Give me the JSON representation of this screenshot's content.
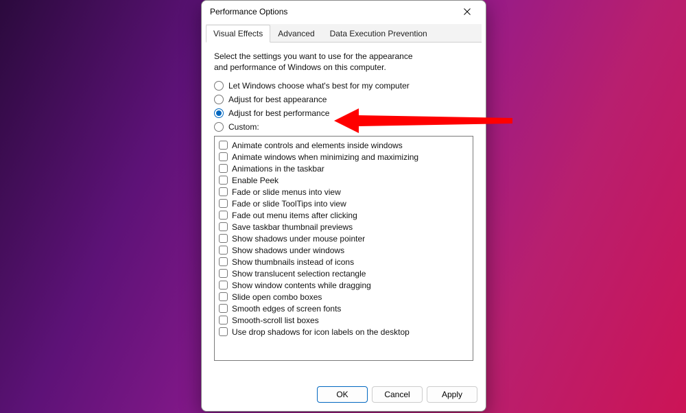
{
  "window": {
    "title": "Performance Options"
  },
  "tabs": [
    {
      "label": "Visual Effects",
      "active": true
    },
    {
      "label": "Advanced",
      "active": false
    },
    {
      "label": "Data Execution Prevention",
      "active": false
    }
  ],
  "description": "Select the settings you want to use for the appearance and performance of Windows on this computer.",
  "radios": [
    {
      "label": "Let Windows choose what's best for my computer",
      "selected": false
    },
    {
      "label": "Adjust for best appearance",
      "selected": false
    },
    {
      "label": "Adjust for best performance",
      "selected": true
    },
    {
      "label": "Custom:",
      "selected": false
    }
  ],
  "checklist": [
    "Animate controls and elements inside windows",
    "Animate windows when minimizing and maximizing",
    "Animations in the taskbar",
    "Enable Peek",
    "Fade or slide menus into view",
    "Fade or slide ToolTips into view",
    "Fade out menu items after clicking",
    "Save taskbar thumbnail previews",
    "Show shadows under mouse pointer",
    "Show shadows under windows",
    "Show thumbnails instead of icons",
    "Show translucent selection rectangle",
    "Show window contents while dragging",
    "Slide open combo boxes",
    "Smooth edges of screen fonts",
    "Smooth-scroll list boxes",
    "Use drop shadows for icon labels on the desktop"
  ],
  "buttons": {
    "ok": "OK",
    "cancel": "Cancel",
    "apply": "Apply"
  },
  "annotation": {
    "arrow_color": "#ff0000"
  }
}
